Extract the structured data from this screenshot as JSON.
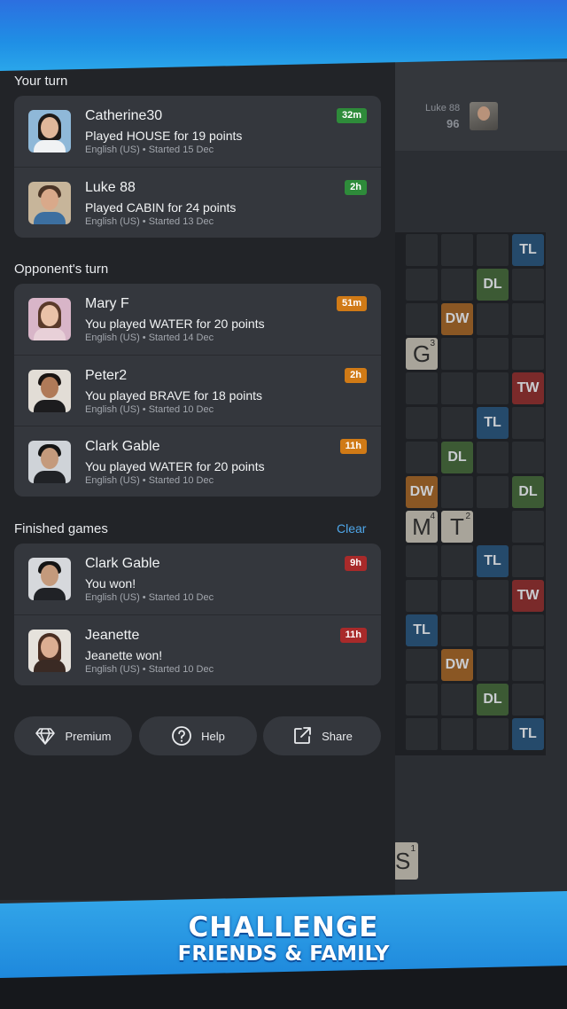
{
  "banner": {
    "line1": "CHALLENGE",
    "line2": "FRIENDS & FAMILY"
  },
  "game": {
    "opponent_name": "Luke 88",
    "opponent_score": "96",
    "premium_labels": {
      "tl": "TL",
      "dl": "DL",
      "dw": "DW",
      "tw": "TW"
    },
    "tiles": [
      {
        "letter": "G",
        "value": "3"
      },
      {
        "letter": "M",
        "value": "4"
      },
      {
        "letter": "T",
        "value": "2"
      }
    ],
    "rack_tile": {
      "letter": "S",
      "value": "1"
    }
  },
  "sections": {
    "your_turn": "Your turn",
    "opponents_turn": "Opponent's turn",
    "finished": "Finished games",
    "clear": "Clear"
  },
  "your_turn_games": [
    {
      "name": "Catherine30",
      "desc": "Played HOUSE for 19 points",
      "meta": "English (US) • Started 15 Dec",
      "badge": "32m"
    },
    {
      "name": "Luke 88",
      "desc": "Played CABIN for 24 points",
      "meta": "English (US) • Started 13 Dec",
      "badge": "2h"
    }
  ],
  "opponent_turn_games": [
    {
      "name": "Mary F",
      "desc": "You played WATER for 20 points",
      "meta": "English (US) • Started 14 Dec",
      "badge": "51m"
    },
    {
      "name": "Peter2",
      "desc": "You played BRAVE for 18 points",
      "meta": "English (US) • Started 10 Dec",
      "badge": "2h"
    },
    {
      "name": "Clark Gable",
      "desc": "You played WATER for 20 points",
      "meta": "English (US) • Started 10 Dec",
      "badge": "11h"
    }
  ],
  "finished_games": [
    {
      "name": "Clark Gable",
      "desc": "You won!",
      "meta": "English (US) • Started 10 Dec",
      "badge": "9h"
    },
    {
      "name": "Jeanette",
      "desc": "Jeanette won!",
      "meta": "English (US) • Started 10 Dec",
      "badge": "11h"
    }
  ],
  "buttons": {
    "premium": "Premium",
    "help": "Help",
    "share": "Share"
  },
  "colors": {
    "accent": "#4fa7ea",
    "badge_green": "#2e8b3a",
    "badge_orange": "#d07a16",
    "badge_red": "#a82a2a"
  }
}
